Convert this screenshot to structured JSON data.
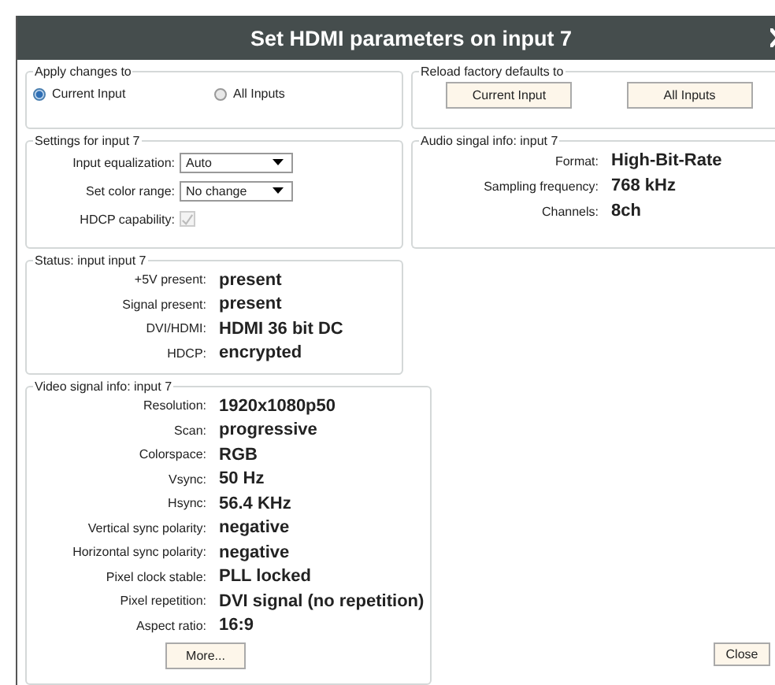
{
  "window": {
    "title": "Set HDMI parameters on input 7"
  },
  "apply_changes": {
    "legend": "Apply changes to",
    "options": [
      {
        "label": "Current Input",
        "selected": true
      },
      {
        "label": "All Inputs",
        "selected": false
      }
    ]
  },
  "reload_defaults": {
    "legend": "Reload factory defaults to",
    "buttons": [
      "Current Input",
      "All Inputs"
    ]
  },
  "settings": {
    "legend": "Settings for input 7",
    "dropdowns": [
      {
        "label": "Input equalization:",
        "value": "Auto"
      },
      {
        "label": "Set color range:",
        "value": "No change"
      }
    ],
    "hdcp_capability": {
      "label": "HDCP capability:",
      "checked": true,
      "disabled": true
    }
  },
  "audio": {
    "legend": "Audio singal info: input 7",
    "rows": [
      {
        "label": "Format:",
        "value": "High-Bit-Rate"
      },
      {
        "label": "Sampling frequency:",
        "value": "768 kHz"
      },
      {
        "label": "Channels:",
        "value": "8ch"
      }
    ]
  },
  "status": {
    "legend": "Status: input input 7",
    "rows": [
      {
        "label": "+5V present:",
        "value": "present"
      },
      {
        "label": "Signal present:",
        "value": "present"
      },
      {
        "label": "DVI/HDMI:",
        "value": "HDMI 36 bit DC"
      },
      {
        "label": "HDCP:",
        "value": "encrypted"
      }
    ]
  },
  "video": {
    "legend": "Video signal info: input 7",
    "rows": [
      {
        "label": "Resolution:",
        "value": "1920x1080p50"
      },
      {
        "label": "Scan:",
        "value": "progressive"
      },
      {
        "label": "Colorspace:",
        "value": "RGB"
      },
      {
        "label": "Vsync:",
        "value": "50 Hz"
      },
      {
        "label": "Hsync:",
        "value": "56.4 KHz"
      },
      {
        "label": "Vertical sync polarity:",
        "value": "negative"
      },
      {
        "label": "Horizontal sync polarity:",
        "value": "negative"
      },
      {
        "label": "Pixel clock stable:",
        "value": "PLL locked"
      },
      {
        "label": "Pixel repetition:",
        "value": "DVI signal (no repetition)"
      },
      {
        "label": "Aspect ratio:",
        "value": "16:9"
      }
    ],
    "button": "More..."
  },
  "footer": {
    "button": "Close"
  }
}
